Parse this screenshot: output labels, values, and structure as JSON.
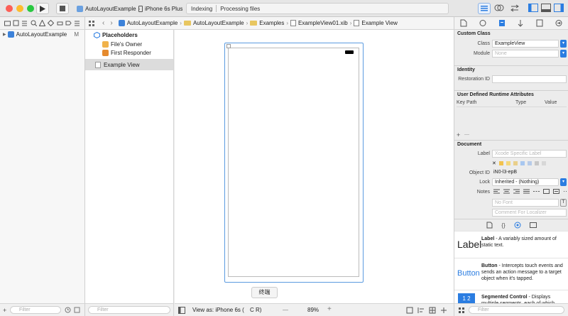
{
  "toolbar": {
    "scheme": "AutoLayoutExample",
    "device": "iPhone 6s Plus",
    "status_primary": "Indexing",
    "status_secondary": "Processing files"
  },
  "navigator": {
    "project": "AutoLayoutExample",
    "project_badge": "M",
    "filter_placeholder": "Filter"
  },
  "jumpbar": {
    "items": [
      "AutoLayoutExample",
      "AutoLayoutExample",
      "Examples",
      "ExampleView01.xib",
      "Example View"
    ]
  },
  "outline": {
    "section": "Placeholders",
    "items": [
      "File's Owner",
      "First Responder"
    ],
    "selected": "Example View",
    "filter_placeholder": "Filter"
  },
  "canvas": {
    "view_as": "View as: iPhone 6s (",
    "view_as_tail": "C  R)",
    "zoom": "89%",
    "tooltip": "终端",
    "zoom_out": "—",
    "zoom_in": "+"
  },
  "inspector": {
    "custom_class": {
      "title": "Custom Class",
      "class_label": "Class",
      "class_value": "ExampleView",
      "module_label": "Module",
      "module_value": "None"
    },
    "identity": {
      "title": "Identity",
      "restoration_label": "Restoration ID"
    },
    "runtime": {
      "title": "User Defined Runtime Attributes",
      "col_key": "Key Path",
      "col_type": "Type",
      "col_value": "Value",
      "add": "+",
      "remove": "—"
    },
    "document": {
      "title": "Document",
      "label_label": "Label",
      "label_placeholder": "Xcode Specific Label",
      "object_id_label": "Object ID",
      "object_id": "iN0-l3-epB",
      "lock_label": "Lock",
      "lock_value": "Inherited - (Nothing)",
      "notes_label": "Notes",
      "font_placeholder": "No Font",
      "comment_placeholder": "Comment For Localizer",
      "clear": "✕"
    },
    "library": [
      {
        "name": "Label",
        "icon": "Label",
        "desc": " - A variably sized amount of static text."
      },
      {
        "name": "Button",
        "icon": "Button",
        "desc": " - Intercepts touch events and sends an action message to a target object when it's tapped."
      },
      {
        "name": "Segmented Control",
        "icon": "1  2",
        "desc": " - Displays multiple segments, each of which"
      }
    ],
    "filter_placeholder": "Filter"
  },
  "colors": {
    "accent": "#2b7de1",
    "selection": "#dcdcdc",
    "close": "#fc5f57",
    "minimize": "#fdbc2e",
    "zoom": "#28c840"
  }
}
